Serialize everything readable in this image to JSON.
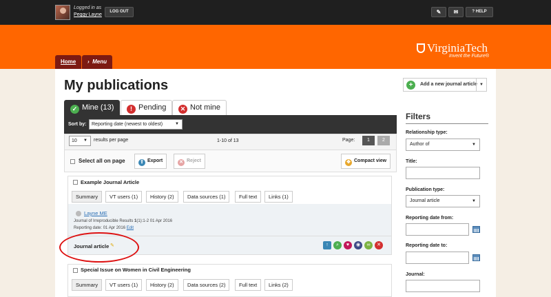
{
  "header": {
    "logged_in_as": "Logged in as",
    "user_name": "Peggy Layne",
    "logout_label": "LOG OUT",
    "help_label": "HELP"
  },
  "branding": {
    "logo_text": "VirginiaTech",
    "tagline": "Invent the Future®"
  },
  "breadcrumb": {
    "home": "Home",
    "menu": "Menu"
  },
  "page": {
    "title": "My publications"
  },
  "tabs": [
    {
      "label": "Mine (13)",
      "icon": "check-icon",
      "active": true
    },
    {
      "label": "Pending",
      "icon": "exclamation-icon",
      "active": false
    },
    {
      "label": "Not mine",
      "icon": "x-icon",
      "active": false
    }
  ],
  "sort": {
    "label": "Sort by:",
    "value": "Reporting date (newest to oldest)"
  },
  "pager": {
    "per_page_value": "10",
    "per_page_label": "results per page",
    "count_text": "1-10 of 13",
    "page_label": "Page:",
    "pages": [
      "1",
      "2"
    ],
    "current_page": 1
  },
  "actions": {
    "select_all": "Select all on page",
    "export": "Export",
    "reject": "Reject",
    "compact_view": "Compact view"
  },
  "publications": [
    {
      "title": "Example Journal Article",
      "tabs": [
        "Summary",
        "VT users (1)",
        "History (2)",
        "Data sources (1)",
        "Full text",
        "Links (1)"
      ],
      "author": "Layne ME",
      "journal_prefix": "Journal of Irreproducible Results ",
      "journal_bold": "1",
      "journal_suffix": "(1):1-2 01 Apr 2016",
      "reporting_date": "Reporting date: 01 Apr 2016",
      "edit_label": "Edit",
      "type": "Journal article"
    },
    {
      "title": "Special Issue on Women in Civil Engineering",
      "tabs": [
        "Summary",
        "VT users (1)",
        "History (2)",
        "Data sources (2)",
        "Full text",
        "Links (2)"
      ]
    }
  ],
  "sidebar": {
    "add_button": "Add a new journal article",
    "filters_title": "Filters",
    "relationship_label": "Relationship type:",
    "relationship_value": "Author of",
    "title_label": "Title:",
    "pub_type_label": "Publication type:",
    "pub_type_value": "Journal article",
    "date_from_label": "Reporting date from:",
    "date_to_label": "Reporting date to:",
    "journal_label": "Journal:"
  },
  "colors": {
    "banner": "#ff6600",
    "maroon": "#7d1a12",
    "topbar": "#1f1f1f",
    "annotation": "#dd1111"
  }
}
